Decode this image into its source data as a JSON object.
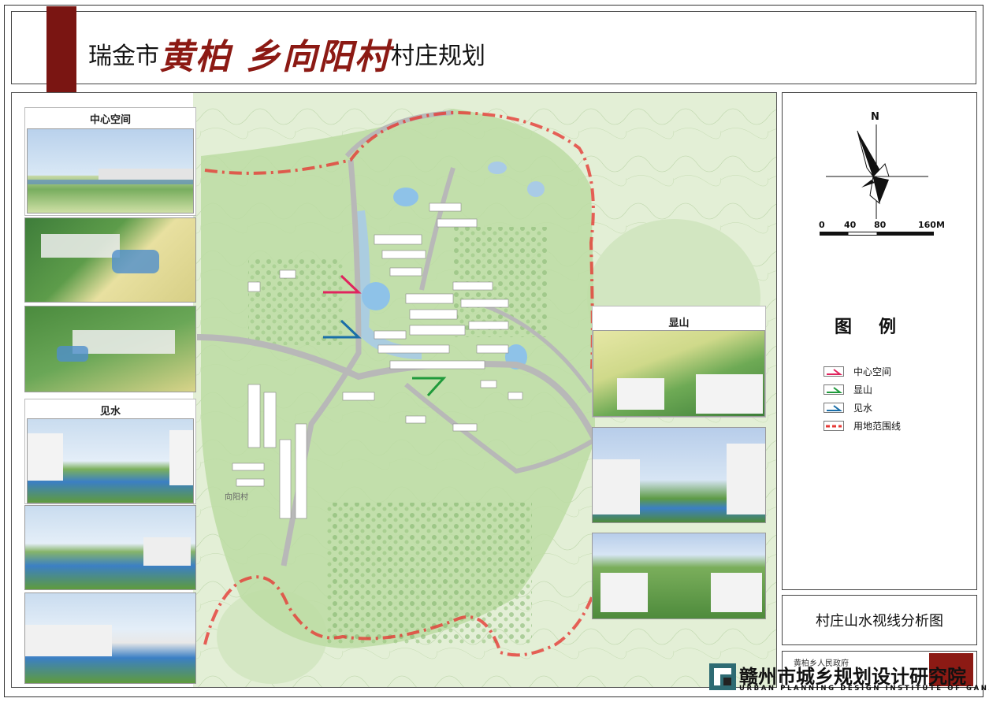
{
  "header": {
    "title_prefix": "瑞金市",
    "title_township": "黄柏",
    "title_village": "乡向阳村",
    "title_suffix": "村庄规划"
  },
  "left_panels": {
    "center_space_label": "中心空间",
    "see_water_label": "见水"
  },
  "right_panels": {
    "show_mountain_label": "显山"
  },
  "map": {
    "village_label": "向阳村"
  },
  "north_arrow": {
    "label": "N"
  },
  "scale_bar": {
    "ticks": [
      "0",
      "40",
      "80",
      "160M"
    ]
  },
  "legend": {
    "title": "图例",
    "items": [
      {
        "label": "中心空间",
        "color": "#e0245e"
      },
      {
        "label": "显山",
        "color": "#1f9a3b"
      },
      {
        "label": "见水",
        "color": "#1a6ea8"
      },
      {
        "label": "用地范围线",
        "color": "#e53935"
      }
    ]
  },
  "drawing_title": "村庄山水视线分析图",
  "footer": {
    "client_text": "黄柏乡人民政府",
    "institute_name": "赣州市城乡规划设计研究院",
    "institute_english": "URBAN PLANNING DESIGN INSTITUTE OF GANZHOU"
  },
  "colors": {
    "brand_red": "#7a1512",
    "boundary_red": "#e53935",
    "map_green": "#cfe6b5"
  }
}
